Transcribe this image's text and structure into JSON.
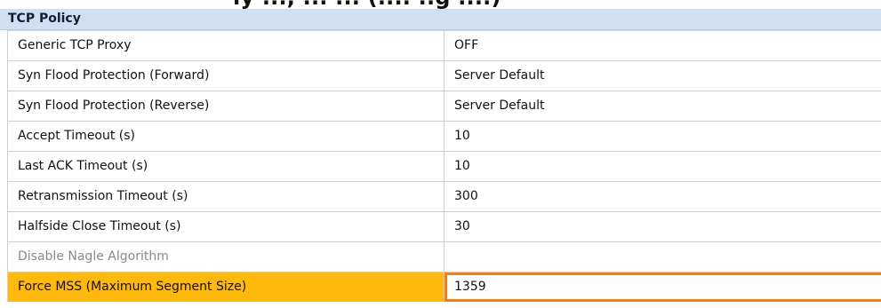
{
  "top_partial_text": "ly ..., ...  ... (....  ..g ....)",
  "section": {
    "title": "TCP Policy"
  },
  "rows": [
    {
      "name": "Generic TCP Proxy",
      "value": "OFF"
    },
    {
      "name": "Syn Flood Protection (Forward)",
      "value": "Server Default"
    },
    {
      "name": "Syn Flood Protection (Reverse)",
      "value": "Server Default"
    },
    {
      "name": "Accept Timeout (s)",
      "value": "10"
    },
    {
      "name": "Last ACK Timeout (s)",
      "value": "10"
    },
    {
      "name": "Retransmission Timeout (s)",
      "value": "300"
    },
    {
      "name": "Halfside Close Timeout (s)",
      "value": "30"
    },
    {
      "name": "Disable Nagle Algorithm",
      "value": ""
    },
    {
      "name": "Force MSS (Maximum Segment Size)",
      "value": "1359"
    }
  ],
  "colors": {
    "header_bg": "#cfe0f2",
    "selected_name_bg": "#ffb90c",
    "selected_value_border": "#f07e1c",
    "disabled_text": "#8a8a8a",
    "grid_line": "#d0d0d0"
  }
}
